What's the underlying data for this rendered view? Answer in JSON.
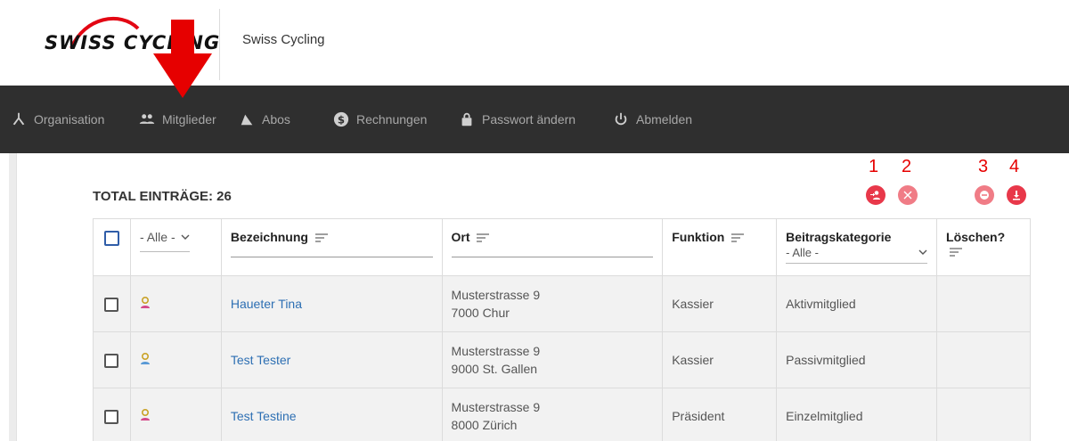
{
  "header": {
    "logo_text": "SWISS CYCLING",
    "org_name": "Swiss Cycling"
  },
  "nav": {
    "items": [
      {
        "label": "Organisation",
        "icon": "organisation-icon"
      },
      {
        "label": "Mitglieder",
        "icon": "members-icon"
      },
      {
        "label": "Abos",
        "icon": "abos-icon"
      },
      {
        "label": "Rechnungen",
        "icon": "dollar-icon"
      },
      {
        "label": "Passwort ändern",
        "icon": "lock-icon"
      },
      {
        "label": "Abmelden",
        "icon": "power-icon"
      }
    ]
  },
  "annotations": {
    "n1": "1",
    "n2": "2",
    "n3": "3",
    "n4": "4"
  },
  "total_label": "TOTAL EINTRÄGE: 26",
  "actions": {
    "add_member": "add-member-icon",
    "remove": "close-icon",
    "deactivate": "minus-icon",
    "export": "download-icon"
  },
  "table": {
    "status_filter": "- Alle -",
    "headers": {
      "name": "Bezeichnung",
      "ort": "Ort",
      "funktion": "Funktion",
      "kategorie": "Beitragskategorie",
      "kategorie_filter": "- Alle -",
      "loeschen": "Löschen?"
    },
    "rows": [
      {
        "name": "Haueter Tina",
        "street": "Musterstrasse 9",
        "city": "7000 Chur",
        "funktion": "Kassier",
        "kategorie": "Aktivmitglied",
        "avatar_color": "#c9a227"
      },
      {
        "name": "Test Tester",
        "street": "Musterstrasse 9",
        "city": "9000 St. Gallen",
        "funktion": "Kassier",
        "kategorie": "Passivmitglied",
        "avatar_color": "#5a9ad6"
      },
      {
        "name": "Test Testine",
        "street": "Musterstrasse 9",
        "city": "8000 Zürich",
        "funktion": "Präsident",
        "kategorie": "Einzelmitglied",
        "avatar_color": "#c9a227"
      }
    ]
  },
  "colors": {
    "nav_bg": "#2f2f2f",
    "accent_red": "#e60000",
    "link_blue": "#2d6fb3"
  }
}
